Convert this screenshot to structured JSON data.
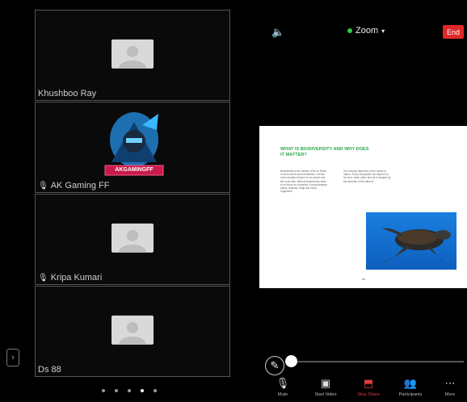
{
  "participants": [
    {
      "name": "Khushboo Ray",
      "muted_icon": false,
      "type": "placeholder"
    },
    {
      "name": "AK Gaming FF",
      "muted_icon": true,
      "type": "logo",
      "logo_text": "AKGAMINGFF"
    },
    {
      "name": "Kripa Kumari",
      "muted_icon": true,
      "type": "placeholder"
    },
    {
      "name": "Ds 88",
      "muted_icon": false,
      "type": "placeholder"
    }
  ],
  "meeting": {
    "title": "Zoom",
    "end_label": "End"
  },
  "slide": {
    "title": "WHAT IS BIODIVERSITY AND WHY DOES IT MATTER?",
    "col1": "Biodiversity is the variety of life on Earth, in all its forms and interactions. It is the most complex feature of our planet and the most vital. Without biodiversity, there is no future for humanity. It encompasses plants, animals, fungi and micro-organisms.",
    "col2": "Our survival depends on the health of nature. Every ecosystem we depend on for food, clean water and air is shaped by the diversity of life within it."
  },
  "toolbar": {
    "items": [
      {
        "label": "Mute",
        "icon": "microphone-icon"
      },
      {
        "label": "Start Video",
        "icon": "video-off-icon"
      },
      {
        "label": "Stop Share",
        "icon": "share-screen-icon"
      },
      {
        "label": "Participants",
        "icon": "participants-icon"
      },
      {
        "label": "More",
        "icon": "more-icon"
      }
    ]
  },
  "share_progress": 0.0,
  "colors": {
    "accent_green": "#2ca84a",
    "end_red": "#e02828",
    "stop_share_red": "#e53b3b"
  }
}
